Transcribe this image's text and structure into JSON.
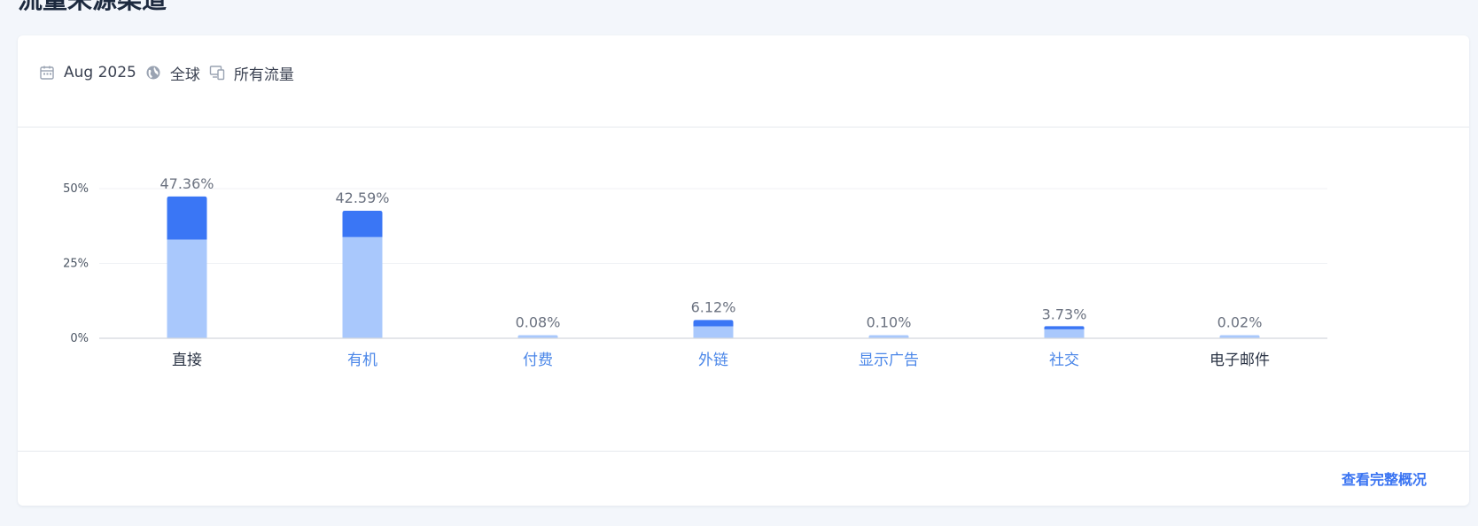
{
  "page": {
    "title": "流量来源渠道"
  },
  "filters": {
    "date": {
      "icon": "calendar-icon",
      "label": "Aug 2025"
    },
    "region": {
      "icon": "globe-icon",
      "label": "全球"
    },
    "traffic": {
      "icon": "devices-icon",
      "label": "所有流量"
    }
  },
  "footer": {
    "link_label": "查看完整概况"
  },
  "colors": {
    "dark_segment": "#3a76f5",
    "light_segment": "#a9c8fc",
    "link": "#4a86e8",
    "text_dark": "#2b3445"
  },
  "chart_data": {
    "type": "bar",
    "stacked": true,
    "categories": [
      "直接",
      "有机",
      "付费",
      "外链",
      "显示广告",
      "社交",
      "电子邮件"
    ],
    "category_links": [
      false,
      true,
      true,
      true,
      true,
      true,
      false
    ],
    "totals": [
      47.36,
      42.59,
      0.08,
      6.12,
      0.1,
      3.73,
      0.02
    ],
    "total_labels": [
      "47.36%",
      "42.59%",
      "0.08%",
      "6.12%",
      "0.10%",
      "3.73%",
      "0.02%"
    ],
    "series": [
      {
        "values": [
          33.0,
          33.8,
          0.08,
          4.0,
          0.1,
          3.0,
          0.02
        ],
        "color": "#a9c8fc"
      },
      {
        "values": [
          14.36,
          8.79,
          0.0,
          2.12,
          0.0,
          0.73,
          0.0
        ],
        "color": "#3a76f5"
      }
    ],
    "y_ticks": [
      0,
      25,
      50
    ],
    "y_tick_labels": [
      "0%",
      "25%",
      "50%"
    ],
    "ylim": [
      0,
      50
    ],
    "grid": true,
    "legend": "none"
  }
}
